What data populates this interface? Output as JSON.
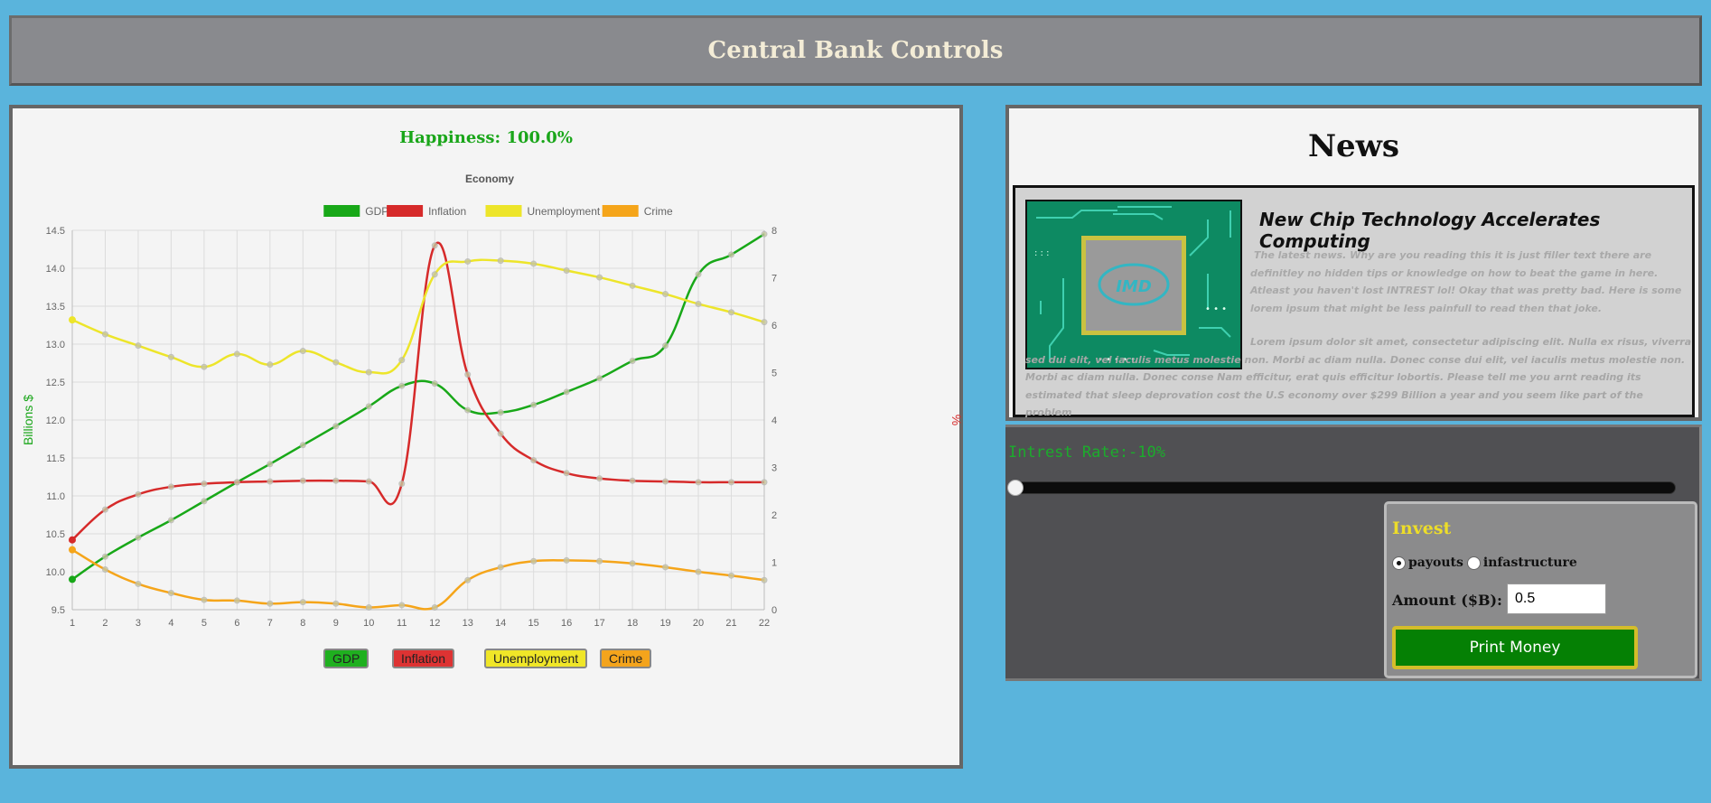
{
  "header": {
    "title": "Central Bank Controls"
  },
  "happiness": "Happiness: 100.0%",
  "chart_data": {
    "type": "line",
    "title": "Economy",
    "x": [
      1,
      2,
      3,
      4,
      5,
      6,
      7,
      8,
      9,
      10,
      11,
      12,
      13,
      14,
      15,
      16,
      17,
      18,
      19,
      20,
      21,
      22
    ],
    "y_left": {
      "label": "Billions $",
      "min": 9.5,
      "max": 14.5,
      "ticks": [
        9.5,
        10.0,
        10.5,
        11.0,
        11.5,
        12.0,
        12.5,
        13.0,
        13.5,
        14.0,
        14.5
      ]
    },
    "y_right": {
      "label": "%",
      "min": 0,
      "max": 8,
      "ticks": [
        0,
        1,
        2,
        3,
        4,
        5,
        6,
        7,
        8
      ]
    },
    "grid": true,
    "legend_position": "top",
    "series": [
      {
        "name": "GDP",
        "axis": "left",
        "color": "#18a818",
        "values": [
          9.9,
          10.2,
          10.45,
          10.68,
          10.93,
          11.18,
          11.42,
          11.67,
          11.92,
          12.18,
          12.45,
          12.48,
          12.13,
          12.1,
          12.2,
          12.37,
          12.55,
          12.78,
          12.98,
          13.92,
          14.18,
          14.45
        ]
      },
      {
        "name": "Inflation",
        "axis": "left",
        "color": "#d62a2a",
        "values": [
          10.42,
          10.82,
          11.02,
          11.12,
          11.16,
          11.18,
          11.19,
          11.2,
          11.2,
          11.19,
          11.16,
          14.3,
          12.6,
          11.82,
          11.47,
          11.3,
          11.23,
          11.2,
          11.19,
          11.18,
          11.18,
          11.18
        ]
      },
      {
        "name": "Unemployment",
        "axis": "left",
        "color": "#ede52a",
        "values": [
          13.32,
          13.13,
          12.98,
          12.83,
          12.7,
          12.87,
          12.73,
          12.91,
          12.76,
          12.63,
          12.79,
          13.92,
          14.09,
          14.1,
          14.06,
          13.97,
          13.88,
          13.77,
          13.66,
          13.53,
          13.42,
          13.29
        ]
      },
      {
        "name": "Crime",
        "axis": "left",
        "color": "#f5a51a",
        "values": [
          10.29,
          10.03,
          9.84,
          9.72,
          9.63,
          9.62,
          9.58,
          9.6,
          9.58,
          9.53,
          9.56,
          9.53,
          9.89,
          10.06,
          10.14,
          10.15,
          10.14,
          10.11,
          10.06,
          10.0,
          9.95,
          9.89
        ]
      }
    ]
  },
  "legend_buttons": [
    {
      "label": "GDP",
      "color": "#1fb01f"
    },
    {
      "label": "Inflation",
      "color": "#dd3333"
    },
    {
      "label": "Unemployment",
      "color": "#f0e628"
    },
    {
      "label": "Crime",
      "color": "#f4a41c"
    }
  ],
  "news": {
    "title": "News",
    "headline": "New Chip Technology Accelerates Computing",
    "image_label": "IMD",
    "paragraph1": "The latest news. Why are you reading this it is just filler text there are definitley no hidden tips or knowledge on how to beat the game in here. Atleast you haven't lost INTREST lol! Okay that was pretty bad. Here is some lorem ipsum that might be less painfull to read then that joke.",
    "paragraph2": "Lorem ipsum dolor sit amet, consectetur adipiscing elit. Nulla ex risus, viverra sed dui elit, vel iaculis metus molestie non. Morbi ac diam nulla. Donec conse dui elit, vel iaculis metus molestie non. Morbi ac diam nulla. Donec conse Nam efficitur, erat quis efficitur lobortis. Please tell me you arnt reading its estimated that sleep deprovation cost the U.S economy over $299 Billion a year and you seem like part of the problem"
  },
  "controls": {
    "rate_label": "Intrest Rate:-10%",
    "rate_value_fraction": 0.0,
    "invest_title": "Invest",
    "radio_payouts": "payouts",
    "radio_infrastructure": "infastructure",
    "selected_radio": "payouts",
    "amount_label": "Amount ($B):",
    "amount_value": "0.5",
    "print_button": "Print Money"
  },
  "colors": {
    "background": "#5ab4dc",
    "happiness": "#1aa61a",
    "rate_label": "#1cac2c",
    "invest_title": "#eddd29",
    "print_button": "#058004"
  }
}
